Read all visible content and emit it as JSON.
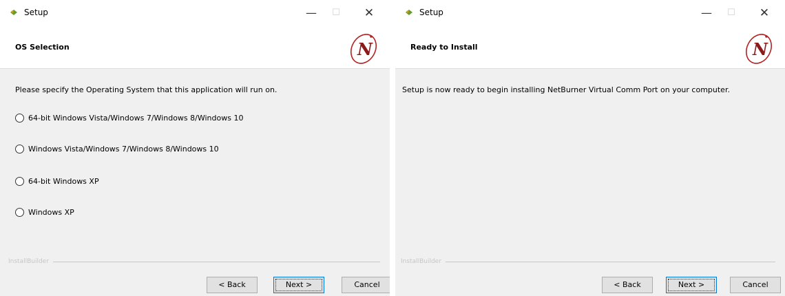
{
  "colors": {
    "header_bg": "#ffffff",
    "body_bg": "#f0f0f0",
    "logo_red": "#b22222",
    "focus_blue": "#0078d7"
  },
  "left": {
    "title": "Setup",
    "controls": {
      "minimize": "—",
      "maximize": "☐",
      "close": "✕"
    },
    "header_title": "OS Selection",
    "description": "Please specify the Operating System that this application will run on.",
    "options": [
      "64-bit Windows Vista/Windows 7/Windows 8/Windows 10",
      "Windows Vista/Windows 7/Windows 8/Windows 10",
      "64-bit Windows XP",
      "Windows XP"
    ],
    "brand": "InstallBuilder",
    "buttons": {
      "back": "< Back",
      "next": "Next >",
      "cancel": "Cancel"
    },
    "logo_letter": "N"
  },
  "right": {
    "title": "Setup",
    "controls": {
      "minimize": "—",
      "maximize": "☐",
      "close": "✕"
    },
    "header_title": "Ready to Install",
    "description": "Setup is now ready to begin installing NetBurner Virtual Comm Port on your computer.",
    "brand": "InstallBuilder",
    "buttons": {
      "back": "< Back",
      "next": "Next >",
      "cancel": "Cancel"
    },
    "logo_letter": "N"
  }
}
